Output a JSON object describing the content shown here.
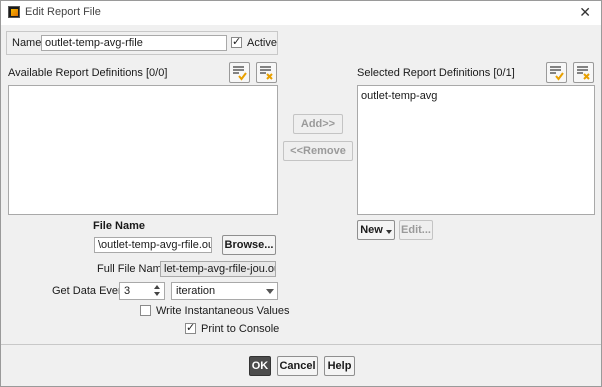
{
  "window": {
    "title": "Edit Report File",
    "close_glyph": "✕"
  },
  "name_row": {
    "label": "Name",
    "value": "outlet-temp-avg-rfile",
    "active_label": "Active",
    "active_checked": true
  },
  "available": {
    "label": "Available Report Definitions [0/0]",
    "items": []
  },
  "selected": {
    "label": "Selected Report Definitions [0/1]",
    "items": [
      "outlet-temp-avg"
    ]
  },
  "middle_buttons": {
    "add": "Add>>",
    "remove": "<<Remove"
  },
  "selected_buttons": {
    "new": "New",
    "edit": "Edit..."
  },
  "file": {
    "heading": "File Name",
    "value": "\\outlet-temp-avg-rfile.out",
    "browse": "Browse...",
    "full_label": "Full File Name",
    "full_value": "let-temp-avg-rfile-jou.out"
  },
  "get_data": {
    "label": "Get Data Every",
    "value": "3",
    "unit": "iteration"
  },
  "options": {
    "write_instantaneous": "Write Instantaneous Values",
    "write_instantaneous_checked": false,
    "print_console": "Print to Console",
    "print_console_checked": true
  },
  "footer": {
    "ok": "OK",
    "cancel": "Cancel",
    "help": "Help"
  },
  "icons": {
    "select_all": "select-all-icon",
    "deselect_all": "deselect-all-icon"
  }
}
